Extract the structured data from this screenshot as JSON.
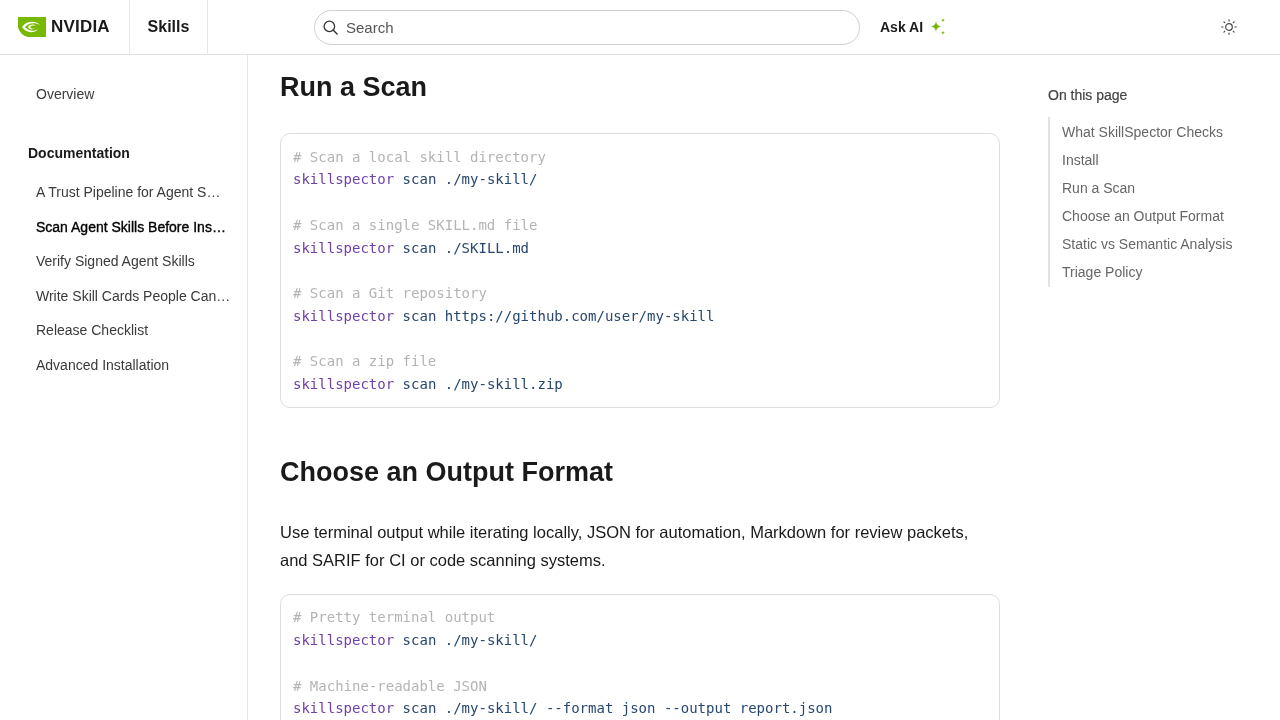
{
  "header": {
    "logo": {
      "text": "NVIDIA"
    },
    "section_title": "Skills",
    "search": {
      "placeholder": "Search"
    },
    "ask_ai": "Ask AI"
  },
  "sidebar": {
    "items": [
      {
        "label": "Overview",
        "selected": false
      }
    ],
    "groups": [
      {
        "title": "Documentation",
        "items": [
          {
            "label": "A Trust Pipeline for Agent S…",
            "selected": false
          },
          {
            "label": "Scan Agent Skills Before Ins…",
            "selected": true
          },
          {
            "label": "Verify Signed Agent Skills",
            "selected": false
          },
          {
            "label": "Write Skill Cards People Can…",
            "selected": false
          },
          {
            "label": "Release Checklist",
            "selected": false
          },
          {
            "label": "Advanced Installation",
            "selected": false
          }
        ]
      }
    ]
  },
  "content": {
    "sections": [
      {
        "heading": "Run a Scan",
        "blocks": [
          {
            "kind": "code",
            "snippets": [
              {
                "comment": "# Scan a local skill directory",
                "command": "skillspector",
                "args": "scan ./my-skill/"
              },
              {
                "comment": "# Scan a single SKILL.md file",
                "command": "skillspector",
                "args": "scan ./SKILL.md"
              },
              {
                "comment": "# Scan a Git repository",
                "command": "skillspector",
                "args": "scan https://github.com/user/my-skill"
              },
              {
                "comment": "# Scan a zip file",
                "command": "skillspector",
                "args": "scan ./my-skill.zip"
              }
            ]
          }
        ]
      },
      {
        "heading": "Choose an Output Format",
        "blocks": [
          {
            "kind": "paragraph",
            "text": "Use terminal output while iterating locally, JSON for automation, Markdown for review packets, and SARIF for CI or code scanning systems."
          },
          {
            "kind": "code",
            "snippets": [
              {
                "comment": "# Pretty terminal output",
                "command": "skillspector",
                "args": "scan ./my-skill/"
              },
              {
                "comment": "# Machine-readable JSON",
                "command": "skillspector",
                "args": "scan ./my-skill/ --format json --output report.json"
              }
            ]
          }
        ]
      }
    ]
  },
  "toc": {
    "title": "On this page",
    "items": [
      "What SkillSpector Checks",
      "Install",
      "Run a Scan",
      "Choose an Output Format",
      "Static vs Semantic Analysis",
      "Triage Policy"
    ]
  }
}
